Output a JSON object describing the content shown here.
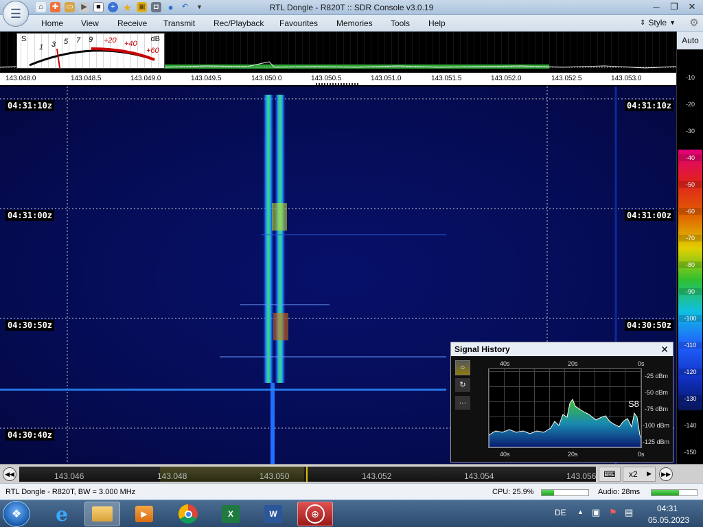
{
  "window": {
    "title": "RTL Dongle - R820T :: SDR Console v3.0.19",
    "minimize": "─",
    "maximize": "❐",
    "close": "✕"
  },
  "menu": {
    "items": [
      "Home",
      "View",
      "Receive",
      "Transmit",
      "Rec/Playback",
      "Favourites",
      "Memories",
      "Tools",
      "Help"
    ],
    "style_label": "Style"
  },
  "smeter": {
    "s_label": "S",
    "db_label": "dB",
    "s_ticks": [
      "1",
      "3",
      "5",
      "7",
      "9"
    ],
    "db_ticks": [
      "+20",
      "+40",
      "+60"
    ]
  },
  "spectrum": {
    "freq_labels": [
      "143.048.0",
      "143.048.5",
      "143.049.0",
      "143.049.5",
      "143.050.0",
      "143.050.5",
      "143.051.0",
      "143.051.5",
      "143.052.0",
      "143.052.5",
      "143.053.0"
    ]
  },
  "waterfall": {
    "timestamps": [
      "04:31:10z",
      "04:31:00z",
      "04:30:50z",
      "04:30:40z"
    ]
  },
  "scale": {
    "auto_label": "Auto",
    "db_values": [
      "-10",
      "-20",
      "-30",
      "-40",
      "-50",
      "-60",
      "-70",
      "-80",
      "-90",
      "-100",
      "-110",
      "-120",
      "-130",
      "-140",
      "-150"
    ],
    "colors": [
      "#000000",
      "#000000",
      "#000000",
      "#e0007a",
      "#e02020",
      "#e04010",
      "#e08000",
      "#e0d000",
      "#20c020",
      "#10c0e0",
      "#2060ff",
      "#1030c0",
      "#0a1870",
      "#000000",
      "#000000"
    ]
  },
  "signal_history": {
    "title": "Signal History",
    "close": "✕",
    "time_labels_top": [
      "40s",
      "20s",
      "0s"
    ],
    "time_labels_bottom": [
      "40s",
      "20s",
      "0s"
    ],
    "level_labels": [
      "-25 dBm",
      "-50 dBm",
      "-75 dBm",
      "-100 dBm",
      "-125 dBm"
    ],
    "s_reading": "S8"
  },
  "tuning": {
    "labels": [
      "143.046",
      "143.048",
      "143.050",
      "143.052",
      "143.054",
      "143.056"
    ],
    "zoom": "x2"
  },
  "status": {
    "device": "RTL Dongle - R820T, BW = 3.000 MHz",
    "cpu": "CPU: 25.9%",
    "cpu_level": 0.26,
    "audio": "Audio: 28ms",
    "audio_level": 0.6
  },
  "taskbar": {
    "lang": "DE",
    "time": "04:31",
    "date": "05.05.2023"
  }
}
